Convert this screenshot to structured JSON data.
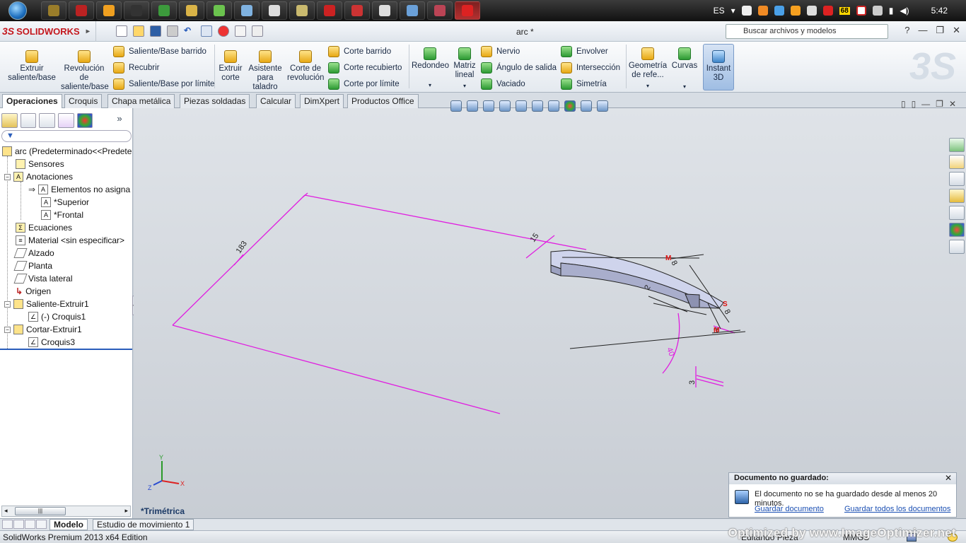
{
  "taskbar": {
    "apps": [
      {
        "name": "app-1",
        "color": "#9a7d2a"
      },
      {
        "name": "app-2",
        "color": "#b22"
      },
      {
        "name": "app-3",
        "color": "#f0a020"
      },
      {
        "name": "app-4",
        "color": "#333"
      },
      {
        "name": "chrome",
        "color": "#3c9a3c"
      },
      {
        "name": "explorer",
        "color": "#d9b347"
      },
      {
        "name": "app-7",
        "color": "#6bc34e"
      },
      {
        "name": "notepad",
        "color": "#7fb2e0"
      },
      {
        "name": "app-9",
        "color": "#ddd"
      },
      {
        "name": "app-10",
        "color": "#c9b96e"
      },
      {
        "name": "acrobat",
        "color": "#c22"
      },
      {
        "name": "app-12",
        "color": "#c33"
      },
      {
        "name": "app-13",
        "color": "#ddd"
      },
      {
        "name": "app-14",
        "color": "#6aa0d8"
      },
      {
        "name": "app-15",
        "color": "#b45"
      },
      {
        "name": "solidworks",
        "color": "#d22"
      }
    ],
    "lang": "ES",
    "badge": "68",
    "clock": "5:42"
  },
  "titlebar": {
    "brand_ds": "3S",
    "brand": "SOLIDWORKS",
    "doc_title": "arc *",
    "search_placeholder": "Buscar archivos y modelos",
    "help": "?",
    "min": "—",
    "max": "❐",
    "close": "✕"
  },
  "ribbon": {
    "extruir": "Extruir saliente/base",
    "revolucion": "Revolución de saliente/base",
    "barrido": "Saliente/Base barrido",
    "recubrir": "Recubrir",
    "limite": "Saliente/Base por límite",
    "extruir_corte": "Extruir corte",
    "asistente": "Asistente para taladro",
    "corte_rev": "Corte de revolución",
    "corte_barrido": "Corte barrido",
    "corte_recubierto": "Corte recubierto",
    "corte_limite": "Corte por límite",
    "redondeo": "Redondeo",
    "matriz": "Matriz lineal",
    "nervio": "Nervio",
    "angulo": "Ángulo de salida",
    "vaciado": "Vaciado",
    "envolver": "Envolver",
    "interseccion": "Intersección",
    "simetria": "Simetría",
    "geometria": "Geometría de refe...",
    "curvas": "Curvas",
    "instant": "Instant 3D"
  },
  "tabs": [
    "Operaciones",
    "Croquis",
    "Chapa metálica",
    "Piezas soldadas",
    "Calcular",
    "DimXpert",
    "Productos Office"
  ],
  "tree": {
    "root": "arc  (Predeterminado<<Predete",
    "sensores": "Sensores",
    "anotaciones": "Anotaciones",
    "elementos": "Elementos no asigna",
    "superior": "*Superior",
    "frontal": "*Frontal",
    "ecuaciones": "Ecuaciones",
    "material": "Material <sin especificar>",
    "alzado": "Alzado",
    "planta": "Planta",
    "vista_lateral": "Vista lateral",
    "origen": "Origen",
    "saliente": "Saliente-Extruir1",
    "croquis1": "(-) Croquis1",
    "cortar": "Cortar-Extruir1",
    "croquis3": "Croquis3"
  },
  "viewport": {
    "view_name": "*Trimétrica",
    "axis_x": "X",
    "axis_y": "Y",
    "axis_z": "Z",
    "dims": {
      "d183": "183",
      "d15": "15",
      "d40": "40",
      "d3": "3",
      "d8": "8",
      "d8b": "8",
      "d2": "2",
      "d3b": "3"
    }
  },
  "notification": {
    "title": "Documento no guardado:",
    "body": "El documento no se ha guardado desde al menos 20 minutos.",
    "link1": "Guardar documento",
    "link2": "Guardar todos los documentos"
  },
  "bottom_tabs": [
    "Modelo",
    "Estudio de movimiento 1"
  ],
  "status": {
    "edition": "SolidWorks Premium 2013 x64 Edition",
    "editing": "Editando Pieza",
    "units": "MMGS"
  },
  "watermark": "Optimized by www.ImageOptimizer.net"
}
